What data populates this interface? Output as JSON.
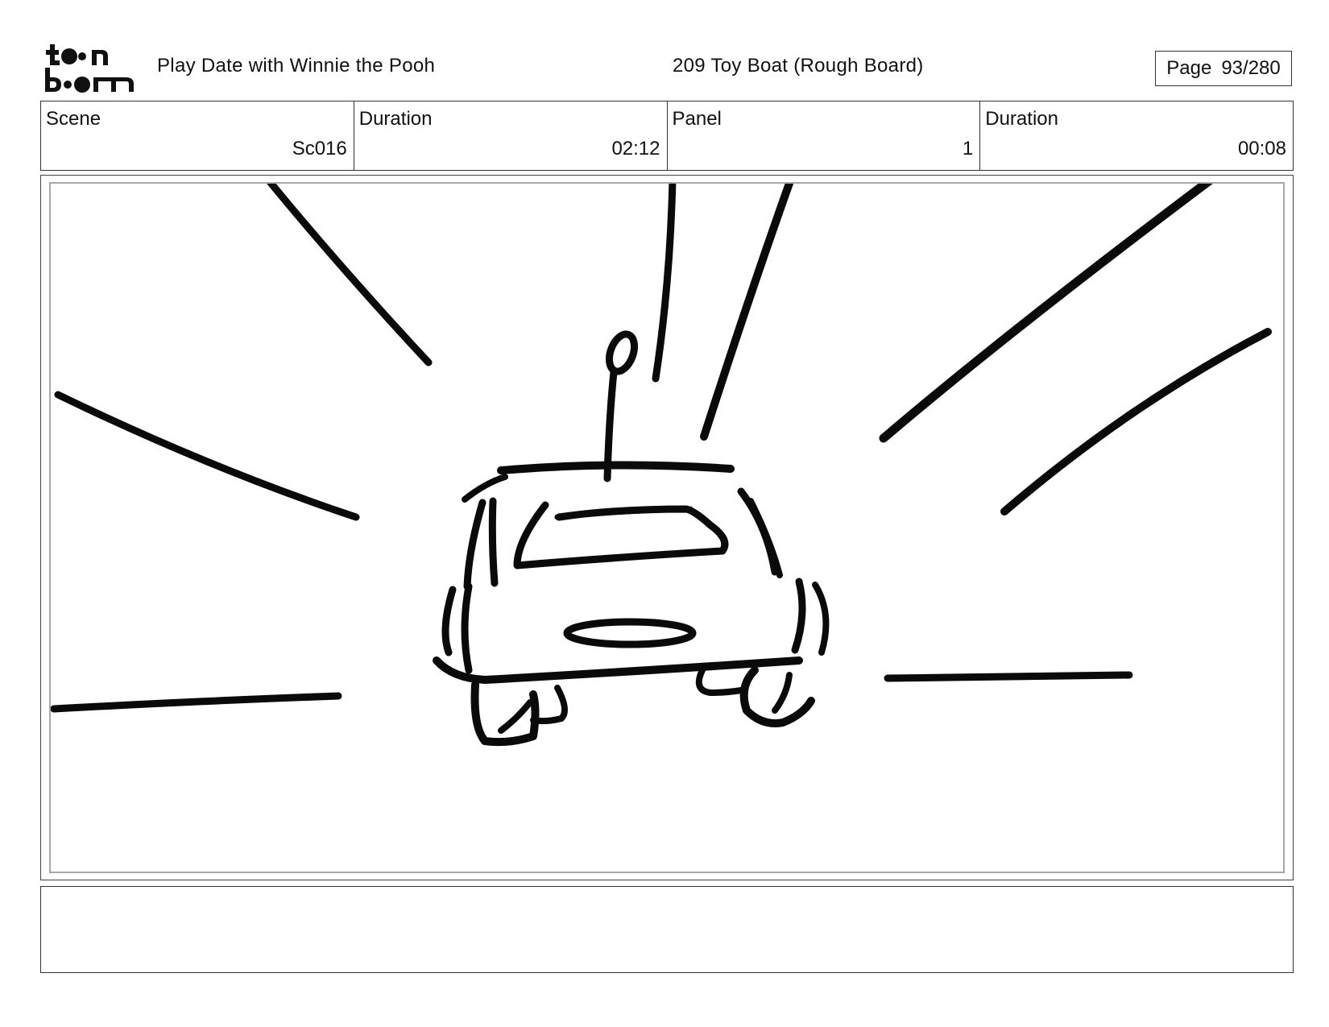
{
  "logo": {
    "top_text": "toon",
    "bottom_text": "boom"
  },
  "header": {
    "project_title": "Play Date with Winnie the Pooh",
    "episode_title": "209 Toy Boat (Rough Board)",
    "page_label": "Page",
    "page_value": "93/280"
  },
  "info": {
    "scene_label": "Scene",
    "scene_value": "Sc016",
    "scene_duration_label": "Duration",
    "scene_duration_value": "02:12",
    "panel_label": "Panel",
    "panel_value": "1",
    "panel_duration_label": "Duration",
    "panel_duration_value": "00:08"
  },
  "panel": {
    "sketch_subject": "rear view of toy car with antenna on road with speed lines"
  },
  "notes": {}
}
